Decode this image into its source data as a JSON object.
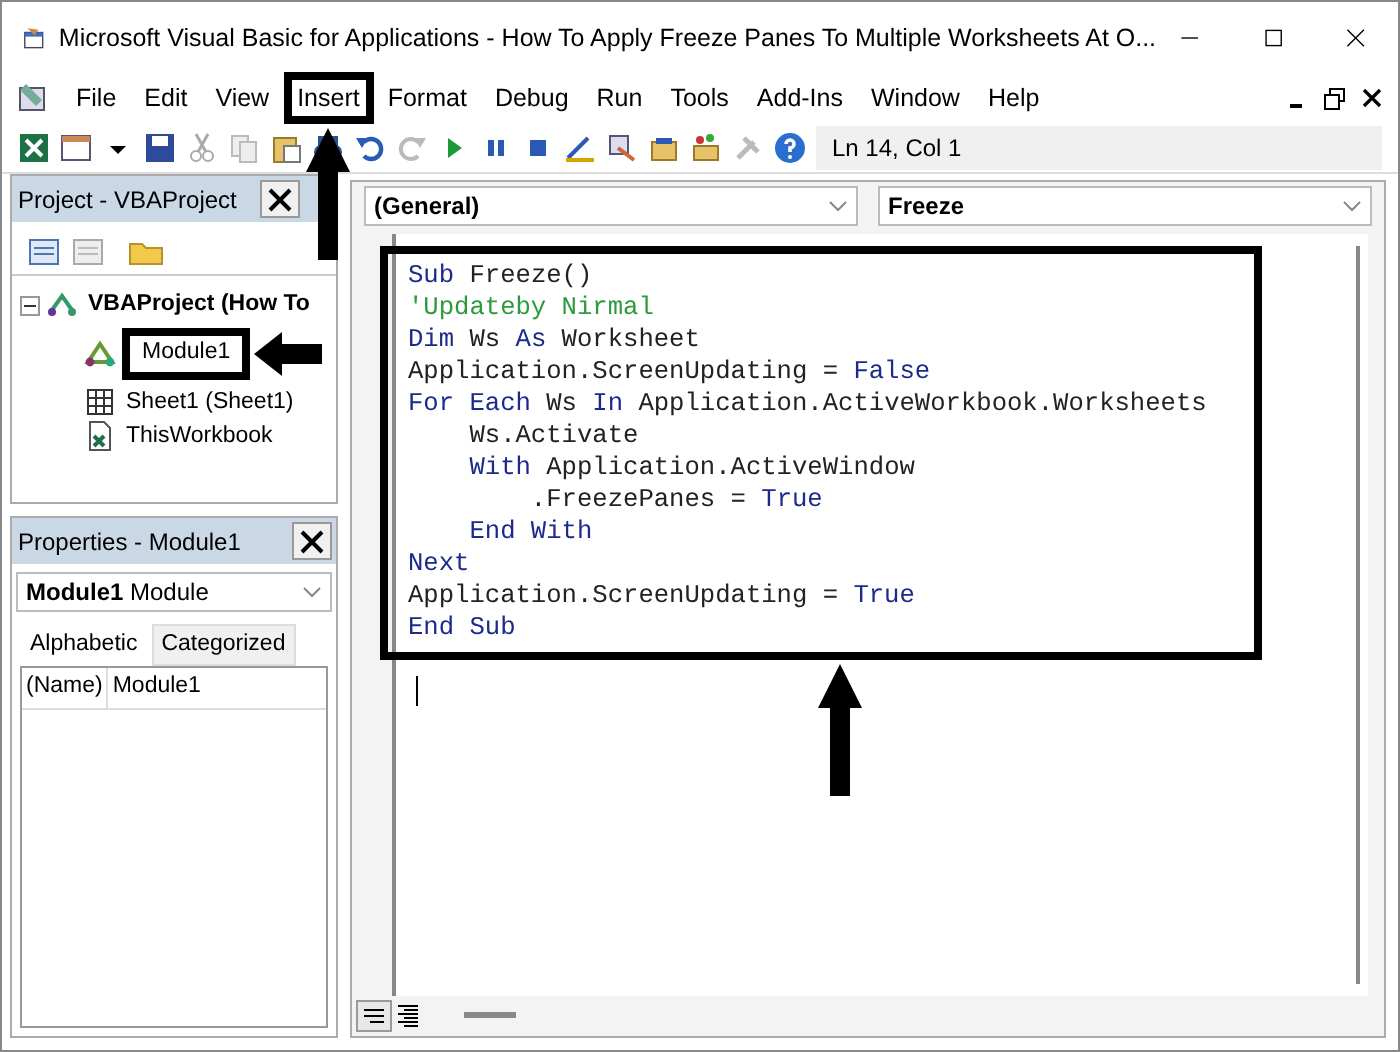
{
  "window": {
    "title": "Microsoft Visual Basic for Applications - How To Apply Freeze Panes To Multiple Worksheets At O..."
  },
  "menu": [
    {
      "label": "File",
      "highlighted": false
    },
    {
      "label": "Edit",
      "highlighted": false
    },
    {
      "label": "View",
      "highlighted": false
    },
    {
      "label": "Insert",
      "highlighted": true
    },
    {
      "label": "Format",
      "highlighted": false
    },
    {
      "label": "Debug",
      "highlighted": false
    },
    {
      "label": "Run",
      "highlighted": false
    },
    {
      "label": "Tools",
      "highlighted": false
    },
    {
      "label": "Add-Ins",
      "highlighted": false
    },
    {
      "label": "Window",
      "highlighted": false
    },
    {
      "label": "Help",
      "highlighted": false
    }
  ],
  "toolbar": {
    "position": "Ln 14, Col 1"
  },
  "project": {
    "title": "Project - VBAProject",
    "tree": [
      {
        "label": "VBAProject (How To",
        "kind": "project",
        "expanded": true,
        "highlighted": false,
        "children": [
          {
            "label": "Module1",
            "kind": "module",
            "highlighted": true
          },
          {
            "label": "Sheet1 (Sheet1)",
            "kind": "sheet",
            "highlighted": false
          },
          {
            "label": "ThisWorkbook",
            "kind": "workbook",
            "highlighted": false
          }
        ]
      }
    ]
  },
  "properties": {
    "title": "Properties - Module1",
    "object": "**Module1** Module",
    "tabs": [
      {
        "label": "Alphabetic",
        "selected": true
      },
      {
        "label": "Categorized",
        "selected": false
      }
    ],
    "rows": [
      {
        "name": "(Name)",
        "value": "Module1"
      }
    ]
  },
  "code": {
    "object": "(General)",
    "procedure": "Freeze",
    "highlighted": true,
    "lines": [
      [
        {
          "kind": "keyword",
          "text": "Sub"
        },
        {
          "kind": "text",
          "text": " Freeze()"
        }
      ],
      [
        {
          "kind": "comment",
          "text": "'Updateby Nirmal"
        }
      ],
      [
        {
          "kind": "keyword",
          "text": "Dim"
        },
        {
          "kind": "text",
          "text": " Ws "
        },
        {
          "kind": "keyword",
          "text": "As"
        },
        {
          "kind": "text",
          "text": " Worksheet"
        }
      ],
      [
        {
          "kind": "text",
          "text": "Application.ScreenUpdating = "
        },
        {
          "kind": "keyword",
          "text": "False"
        }
      ],
      [
        {
          "kind": "keyword",
          "text": "For Each"
        },
        {
          "kind": "text",
          "text": " Ws "
        },
        {
          "kind": "keyword",
          "text": "In"
        },
        {
          "kind": "text",
          "text": " Application.ActiveWorkbook.Worksheets"
        }
      ],
      [
        {
          "kind": "text",
          "text": "    Ws.Activate"
        }
      ],
      [
        {
          "kind": "keyword",
          "text": "    With"
        },
        {
          "kind": "text",
          "text": " Application.ActiveWindow"
        }
      ],
      [
        {
          "kind": "text",
          "text": "        .FreezePanes = "
        },
        {
          "kind": "keyword",
          "text": "True"
        }
      ],
      [
        {
          "kind": "keyword",
          "text": "    End With"
        }
      ],
      [
        {
          "kind": "keyword",
          "text": "Next"
        }
      ],
      [
        {
          "kind": "text",
          "text": "Application.ScreenUpdating = "
        },
        {
          "kind": "keyword",
          "text": "True"
        }
      ],
      [
        {
          "kind": "keyword",
          "text": "End Sub"
        }
      ]
    ]
  }
}
